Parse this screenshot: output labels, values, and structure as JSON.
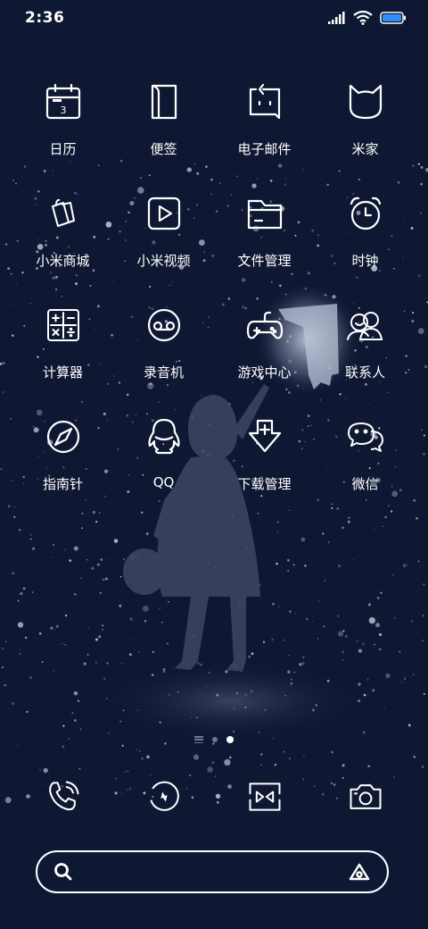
{
  "status_bar": {
    "time": "2:36",
    "battery_level": 1.0
  },
  "colors": {
    "background": "#0f1832",
    "icon_stroke": "#ffffff"
  },
  "apps": [
    {
      "label": "日历",
      "icon": "calendar-icon",
      "badge": "3"
    },
    {
      "label": "便签",
      "icon": "notes-icon"
    },
    {
      "label": "电子邮件",
      "icon": "email-icon"
    },
    {
      "label": "米家",
      "icon": "mijia-icon"
    },
    {
      "label": "小米商城",
      "icon": "mi-store-icon"
    },
    {
      "label": "小米视频",
      "icon": "video-icon"
    },
    {
      "label": "文件管理",
      "icon": "file-manager-icon"
    },
    {
      "label": "时钟",
      "icon": "clock-icon"
    },
    {
      "label": "计算器",
      "icon": "calculator-icon"
    },
    {
      "label": "录音机",
      "icon": "recorder-icon"
    },
    {
      "label": "游戏中心",
      "icon": "game-center-icon"
    },
    {
      "label": "联系人",
      "icon": "contacts-icon"
    },
    {
      "label": "指南针",
      "icon": "compass-icon"
    },
    {
      "label": "QQ",
      "icon": "qq-icon"
    },
    {
      "label": "下载管理",
      "icon": "download-icon"
    },
    {
      "label": "微信",
      "icon": "wechat-icon"
    }
  ],
  "page_indicator": {
    "pages": 1,
    "current": 1
  },
  "dock": [
    "phone-icon",
    "browser-icon",
    "themes-icon",
    "camera-icon"
  ],
  "search": {
    "placeholder": "",
    "value": ""
  }
}
